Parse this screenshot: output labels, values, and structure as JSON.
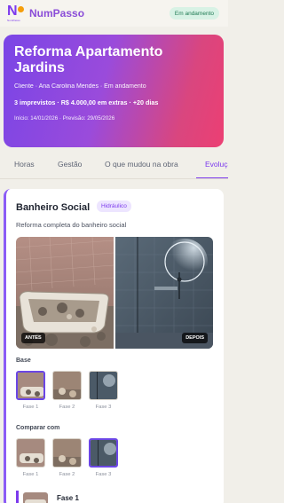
{
  "header": {
    "brand": "NumPasso",
    "logo_sub": "NumPasso",
    "status": "Em andamento"
  },
  "project": {
    "title": "Reforma Apartamento Jardins",
    "meta": "Cliente · Ana Carolina Mendes · Em andamento",
    "stats": "3 imprevistos · R$ 4.000,00 em extras · +20 dias",
    "dates": "Início: 14/01/2026 · Previsão: 29/05/2026"
  },
  "tabs": [
    {
      "label": "Horas"
    },
    {
      "label": "Gestão"
    },
    {
      "label": "O que mudou na obra"
    },
    {
      "label": "Evolução"
    }
  ],
  "room": {
    "title": "Banheiro Social",
    "tag": "Hidráulico",
    "description": "Reforma completa do banheiro social",
    "before_label": "ANTES",
    "after_label": "DEPOIS"
  },
  "base": {
    "label": "Base",
    "phases": [
      "Fase 1",
      "Fase 2",
      "Fase 3"
    ],
    "selected": "Fase 1"
  },
  "compare_with": {
    "label": "Comparar com",
    "phases": [
      "Fase 1",
      "Fase 2",
      "Fase 3"
    ],
    "selected": "Fase 3"
  },
  "phase_list": {
    "first_title": "Fase 1"
  },
  "colors": {
    "accent": "#7c3aed",
    "status_bg": "#d8f2e5",
    "status_text": "#1f7a53",
    "gradient_start": "#7a45e6",
    "gradient_end": "#ec3f73"
  }
}
